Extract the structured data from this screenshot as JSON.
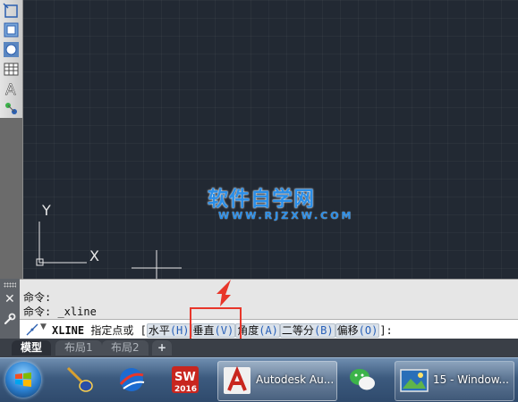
{
  "command_history": {
    "line1": "命令:",
    "line2": "命令: _xline"
  },
  "command_line": {
    "keyword": "XLINE",
    "prompt": " 指定点或 [",
    "options": [
      {
        "label": "水平",
        "key": "(H)"
      },
      {
        "label": "垂直",
        "key": "(V)"
      },
      {
        "label": "角度",
        "key": "(A)"
      },
      {
        "label": "二等分",
        "key": "(B)"
      },
      {
        "label": "偏移",
        "key": "(O)"
      }
    ],
    "suffix": "]:"
  },
  "watermark": {
    "main": "软件自学网",
    "sub": "WWW.RJZXW.COM"
  },
  "ucs": {
    "x_label": "X",
    "y_label": "Y"
  },
  "tabs": {
    "model": "模型",
    "layout1": "布局1",
    "layout2": "布局2",
    "add": "+"
  },
  "taskbar": {
    "autocad_label": "Autodesk Au...",
    "window_label": "15 - Window...",
    "sw_year": "2016"
  },
  "colors": {
    "canvas": "#222933",
    "highlight": "#e8362a",
    "watermark": "#2a8ee8"
  }
}
